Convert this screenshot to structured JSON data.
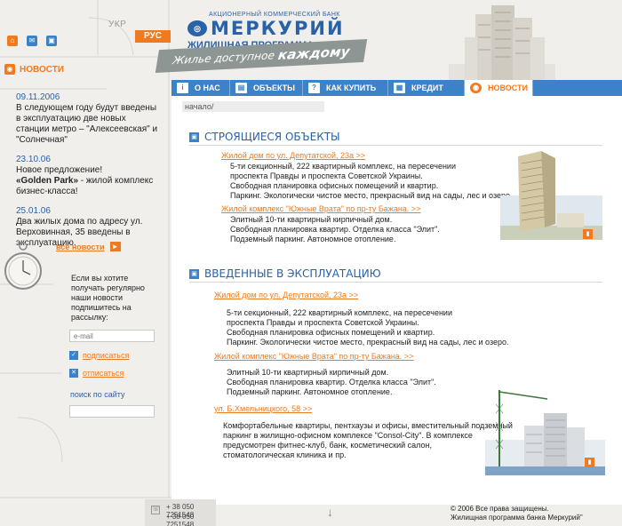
{
  "header": {
    "lang_ukr": "УКР",
    "lang_rus": "РУС",
    "logo_small": "АКЦИОНЕРНЫЙ КОММЕРЧЕСКИЙ БАНК",
    "logo_name": "МЕРКУРИЙ",
    "logo_program": "ЖИЛИЩНАЯ ПРОГРАММА",
    "slogan_prefix": "Жилье доступное",
    "slogan_emph": "каждому"
  },
  "left": {
    "news_label": "НОВОСТИ",
    "news": [
      {
        "date": "09.11.2006",
        "text": "В следующем году будут введены в эксплуатацию две новых станции метро – \"Алексеевская\" и \"Солнечная\""
      },
      {
        "date": "23.10.06",
        "text_pre": "Новое предложение!",
        "text_bold": "«Golden Park»",
        "text_post": " - жилой комплекс бизнес-класса!"
      },
      {
        "date": "25.01.06",
        "text": "Два жилых дома по адресу ул. Верховинная, 35 введены в эксплуатацию."
      }
    ],
    "all_news": "все новости",
    "subscribe_text": "Если вы хотите получать регулярно наши новости подпишитесь на рассылку:",
    "email_placeholder": "e-mail",
    "subscribe": "подписаться",
    "unsubscribe": "отписаться",
    "search_label": "поиск по сайту"
  },
  "nav": {
    "items": [
      {
        "label": "О НАС",
        "icon": "i"
      },
      {
        "label": "ОБЪЕКТЫ",
        "icon": "▤"
      },
      {
        "label": "КАК КУПИТЬ",
        "icon": "?"
      },
      {
        "label": "КРЕДИТ",
        "icon": "▦"
      },
      {
        "label": "НОВОСТИ",
        "icon": "◉"
      }
    ]
  },
  "main": {
    "breadcrumb": "начало/",
    "section1": {
      "title": "СТРОЯЩИЕСЯ ОБЪЕКТЫ",
      "objects": [
        {
          "link": "Жилой дом по ул. Депутатской, 23а >>",
          "lines": [
            "5-ти секционный, 222 квартирный комплекс, на пересечении",
            "проспекта Правды и  проспекта Советской Украины.",
            "Свободная планировка офисных помещений и квартир.",
            "Паркинг. Экологически чистое место, прекрасный вид на сады, лес и озеро."
          ]
        },
        {
          "link": "Жилой комплекс \"Южные Врата\"   по пр-ту Бажана. >>",
          "lines": [
            "Элитный 10-ти квартирный кирпичный дом.",
            "Свободная планировка квартир. Отделка класса \"Элит\".",
            "Подземный паркинг. Автономное отопление."
          ]
        }
      ]
    },
    "section2": {
      "title": "ВВЕДЕННЫЕ В ЭКСПЛУАТАЦИЮ",
      "objects": [
        {
          "link": "Жилой дом по ул. Депутатской, 23а >>",
          "lines": [
            "5-ти секционный, 222 квартирный комплекс, на пересечении",
            "проспекта Правды и  проспекта Советской Украины.",
            "Свободная планировка офисных помещений и квартир.",
            "Паркинг. Экологически чистое место, прекрасный вид на сады, лес и озеро."
          ]
        },
        {
          "link": "Жилой комплекс \"Южные Врата\"   по пр-ту Бажана. >>",
          "lines": [
            "Элитный 10-ти квартирный кирпичный дом.",
            "Свободная планировка квартир. Отделка класса \"Элит\".",
            "Подземный паркинг. Автономное отопление."
          ]
        },
        {
          "link": "ул. Б.Хмельницкого, 58 >>",
          "lines": [
            "Комфортабельные квартиры, пентхаузы и офисы, вместительный подземный",
            "паркинг в жилищно-офисном комплексе \"Consol-City\". В комплексе",
            "предусмотрен фитнес-клуб, банк, косметический салон,",
            "стоматологическая клиника и пр."
          ]
        }
      ]
    }
  },
  "footer": {
    "phone1": "+ 38 050 7251548",
    "phone2": "+ 38 050 7251548",
    "copyright_line1": "© 2006 Все права защищены.",
    "copyright_line2": "Жилищная программа банка Меркурий\""
  },
  "colors": {
    "accent_orange": "#f07a1f",
    "brand_blue": "#2a62a8",
    "nav_blue": "#3c82c8"
  }
}
